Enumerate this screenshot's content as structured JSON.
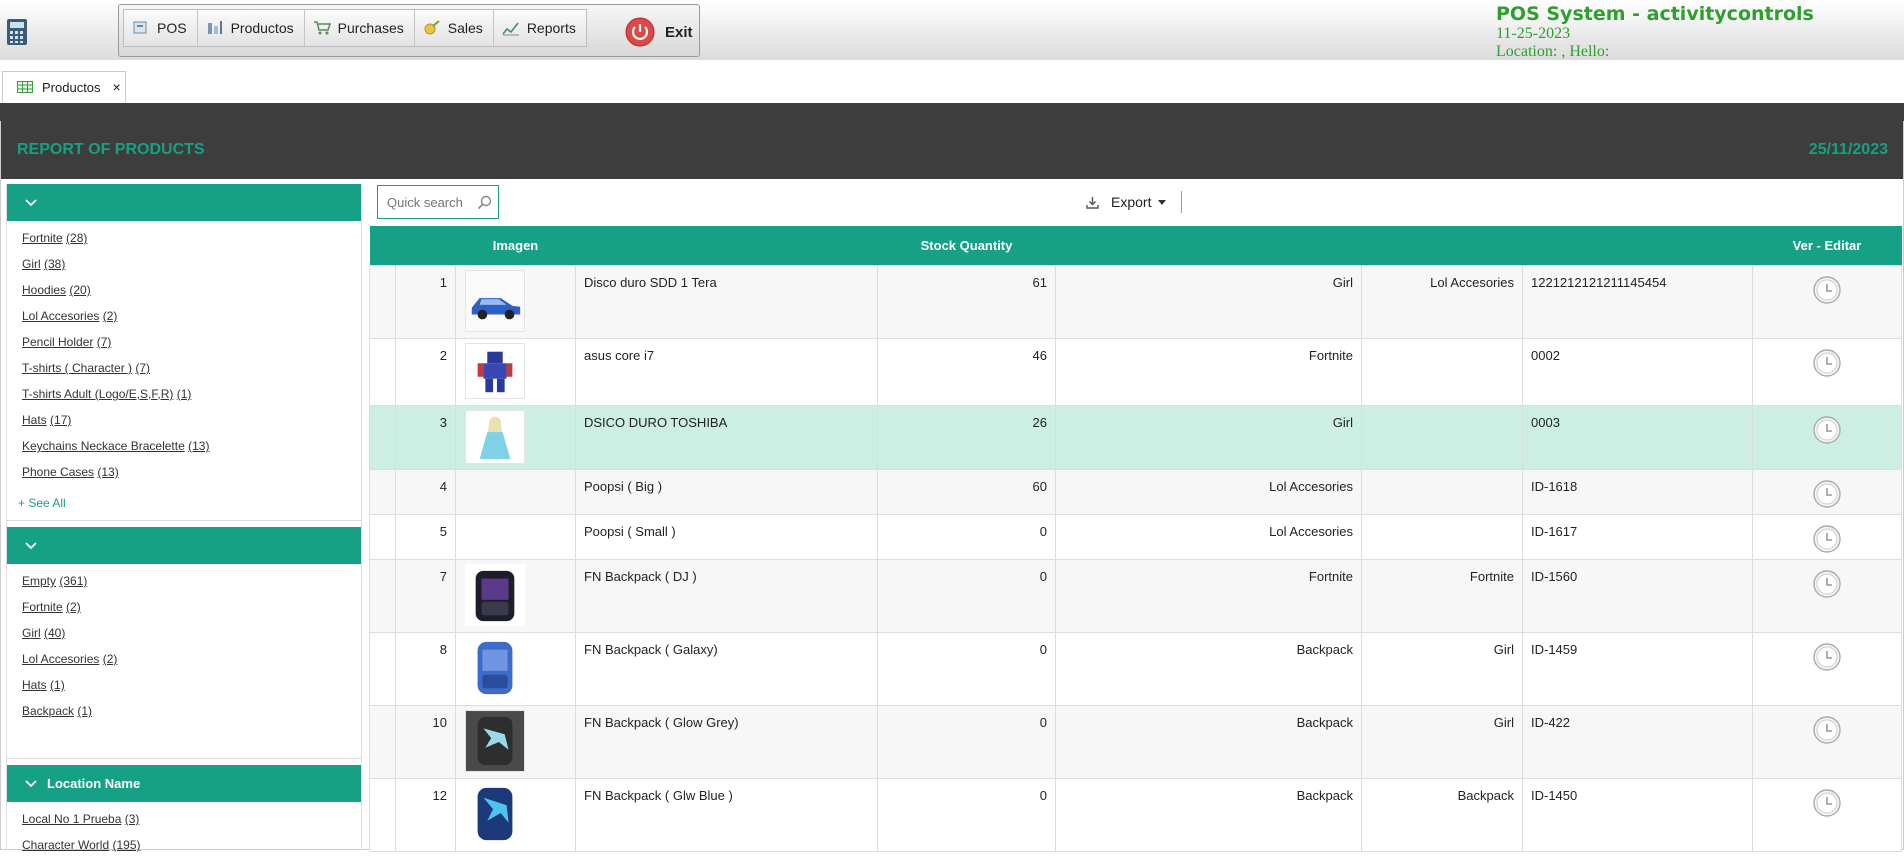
{
  "menu": {
    "items": [
      {
        "label": "POS",
        "icon": "pos-icon"
      },
      {
        "label": "Productos",
        "icon": "products-icon"
      },
      {
        "label": "Purchases",
        "icon": "cart-icon"
      },
      {
        "label": "Sales",
        "icon": "sales-icon"
      },
      {
        "label": "Reports",
        "icon": "reports-icon"
      }
    ],
    "exit_label": "Exit"
  },
  "brand": {
    "title": "POS System - activitycontrols",
    "date": "11-25-2023",
    "location_line": "Location: , Hello:"
  },
  "tab": {
    "label": "Productos",
    "close": "×"
  },
  "report": {
    "title": "REPORT OF PRODUCTS",
    "date": "25/11/2023"
  },
  "sidebar": {
    "facets": [
      {
        "title": "",
        "items": [
          {
            "label": "Fortnite",
            "count": "(28)"
          },
          {
            "label": "Girl",
            "count": "(38)"
          },
          {
            "label": "Hoodies",
            "count": "(20)"
          },
          {
            "label": "Lol Accesories",
            "count": "(2)"
          },
          {
            "label": "Pencil Holder",
            "count": "(7)"
          },
          {
            "label": "T-shirts ( Character )",
            "count": "(7)"
          },
          {
            "label": "T-shirts Adult (Logo/E,S,F,R)",
            "count": "(1)"
          },
          {
            "label": "Hats",
            "count": "(17)"
          },
          {
            "label": "Keychains Neckace Bracelette",
            "count": "(13)"
          },
          {
            "label": "Phone Cases",
            "count": "(13)"
          }
        ],
        "see_all": "+ See All"
      },
      {
        "title": "",
        "items": [
          {
            "label": "Empty",
            "count": "(361)"
          },
          {
            "label": "Fortnite",
            "count": "(2)"
          },
          {
            "label": "Girl",
            "count": "(40)"
          },
          {
            "label": "Lol Accesories",
            "count": "(2)"
          },
          {
            "label": "Hats",
            "count": "(1)"
          },
          {
            "label": "Backpack",
            "count": "(1)"
          }
        ]
      },
      {
        "title": "Location Name",
        "items": [
          {
            "label": "Local No 1 Prueba",
            "count": "(3)"
          },
          {
            "label": "Character World",
            "count": "(195)"
          }
        ]
      }
    ]
  },
  "toolbar": {
    "search_placeholder": "Quick search",
    "export_label": "Export"
  },
  "table": {
    "headers": [
      "",
      "",
      "Imagen",
      "",
      "Stock Quantity",
      "",
      "",
      "",
      "Ver - Editar"
    ],
    "rows": [
      {
        "num": "1",
        "image": "blue-toy-car",
        "name": "Disco duro SDD 1 Tera",
        "stock": "61",
        "category": "Girl",
        "category2": "Lol Accesories",
        "code": "1221212121211145454",
        "style": "even"
      },
      {
        "num": "2",
        "image": "robot-toy",
        "name": "asus core i7",
        "stock": "46",
        "category": "Fortnite",
        "category2": "",
        "code": "0002",
        "style": "odd"
      },
      {
        "num": "3",
        "image": "princess-figure",
        "name": "DSICO DURO TOSHIBA",
        "stock": "26",
        "category": "Girl",
        "category2": "",
        "code": "0003",
        "style": "sel"
      },
      {
        "num": "4",
        "image": "",
        "name": "Poopsi ( Big )",
        "stock": "60",
        "category": "Lol Accesories",
        "category2": "",
        "code": "ID-1618",
        "style": "even"
      },
      {
        "num": "5",
        "image": "",
        "name": "Poopsi ( Small )",
        "stock": "0",
        "category": "Lol Accesories",
        "category2": "",
        "code": "ID-1617",
        "style": "odd"
      },
      {
        "num": "7",
        "image": "backpack-dj",
        "name": "FN Backpack ( DJ )",
        "stock": "0",
        "category": "Fortnite",
        "category2": "Fortnite",
        "code": "ID-1560",
        "style": "even"
      },
      {
        "num": "8",
        "image": "backpack-galaxy",
        "name": "FN Backpack ( Galaxy)",
        "stock": "0",
        "category": "Backpack",
        "category2": "Girl",
        "code": "ID-1459",
        "style": "odd"
      },
      {
        "num": "10",
        "image": "backpack-glow-grey",
        "name": "FN Backpack ( Glow Grey)",
        "stock": "0",
        "category": "Backpack",
        "category2": "Girl",
        "code": "ID-422",
        "style": "even"
      },
      {
        "num": "12",
        "image": "backpack-glow-blue",
        "name": "FN Backpack ( Glw Blue )",
        "stock": "0",
        "category": "Backpack",
        "category2": "Backpack",
        "code": "ID-1450",
        "style": "odd"
      }
    ]
  },
  "colors": {
    "accent": "#16a085",
    "brand_green": "#2e9e2e",
    "dark_bar": "#3d3d3d",
    "selected_row": "#cceee3"
  }
}
